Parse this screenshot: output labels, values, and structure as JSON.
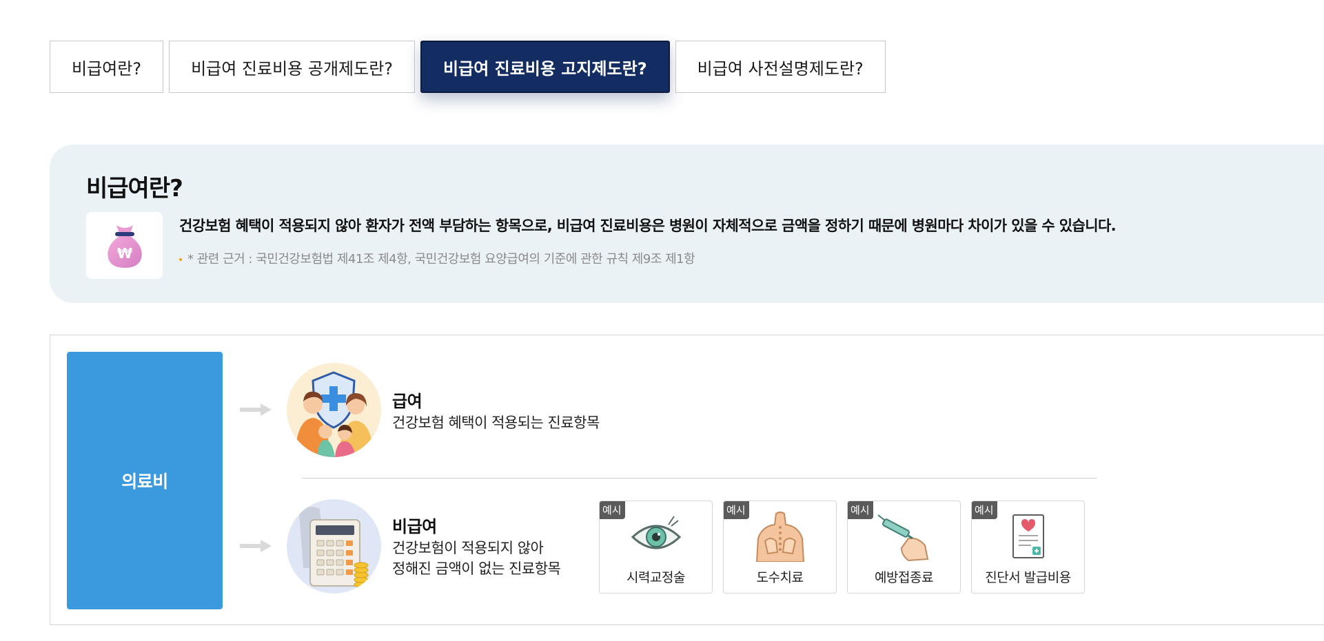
{
  "tabs": [
    {
      "label": "비급여란?",
      "active": false
    },
    {
      "label": "비급여 진료비용 공개제도란?",
      "active": false
    },
    {
      "label": "비급여 진료비용 고지제도란?",
      "active": true
    },
    {
      "label": "비급여 사전설명제도란?",
      "active": false
    }
  ],
  "definition": {
    "title": "비급여란?",
    "icon": "money-bag-icon",
    "text": "건강보험 혜택이 적용되지 않아 환자가 전액 부담하는 항목으로, 비급여 진료비용은 병원이 자체적으로 금액을 정하기 때문에 병원마다 차이가 있을 수 있습니다.",
    "note": "* 관련 근거 : 국민건강보험법 제41조 제4항, 국민건강보험 요양급여의 기준에 관한 규칙 제9조 제1항"
  },
  "diagram": {
    "root_label": "의료비",
    "covered": {
      "title": "급여",
      "desc": "건강보험 혜택이 적용되는 진료항목"
    },
    "non_covered": {
      "title": "비급여",
      "desc_line1": "건강보험이 적용되지 않아",
      "desc_line2": "정해진 금액이 없는 진료항목"
    },
    "example_tag": "예시",
    "examples": [
      {
        "label": "시력교정술",
        "icon": "eye-icon"
      },
      {
        "label": "도수치료",
        "icon": "manual-therapy-icon"
      },
      {
        "label": "예방접종료",
        "icon": "syringe-icon"
      },
      {
        "label": "진단서 발급비용",
        "icon": "certificate-icon"
      }
    ]
  },
  "colors": {
    "tab_active": "#132c62",
    "root_block": "#3b99de",
    "definition_bg": "#ebf2f6",
    "note_dot": "#f5a300"
  }
}
